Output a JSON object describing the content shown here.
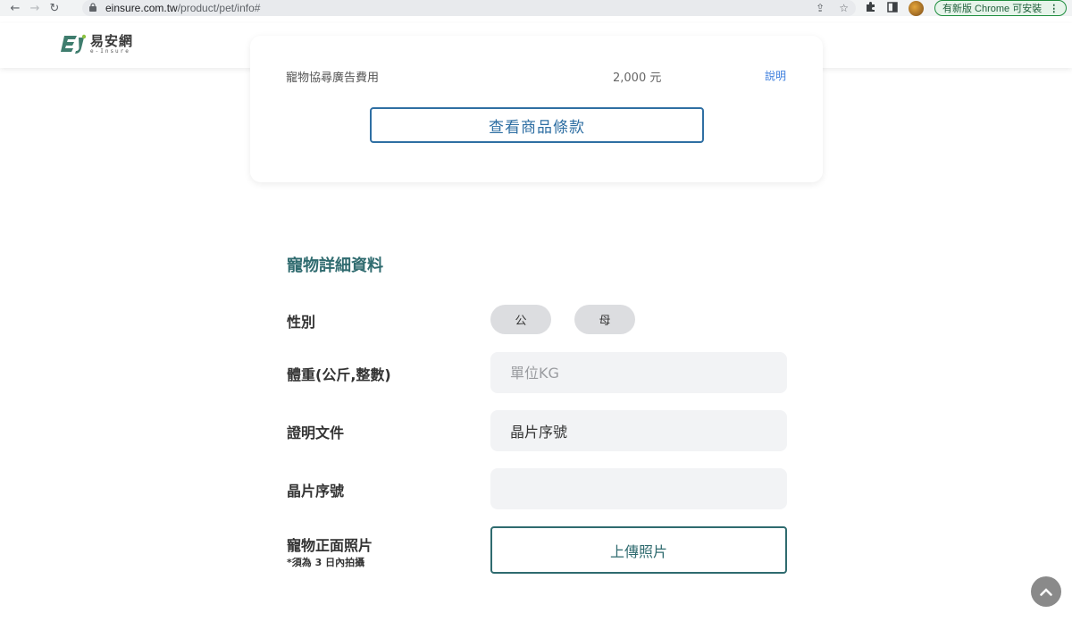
{
  "browser": {
    "url_domain": "einsure.com.tw",
    "url_path": "/product/pet/info#",
    "update_button": "有新版 Chrome 可安裝"
  },
  "site": {
    "logo_cn": "易安網",
    "logo_en": "e-Insure"
  },
  "coverage": {
    "fee_name": "寵物協尋廣告費用",
    "fee_amount": "2,000 元",
    "fee_link": "說明",
    "terms_button": "查看商品條款"
  },
  "pet_details": {
    "title": "寵物詳細資料",
    "gender_label": "性別",
    "gender_options": [
      "公",
      "母"
    ],
    "weight_label": "體重(公斤,整數)",
    "weight_placeholder": "單位KG",
    "document_label": "證明文件",
    "document_value": "晶片序號",
    "chip_label": "晶片序號",
    "chip_value": "",
    "photo_label": "寵物正面照片",
    "photo_note": "*須為 3 日內拍攝",
    "upload_button": "上傳照片"
  },
  "colors": {
    "teal": "#2f6b6f",
    "blue": "#2f6fa3",
    "link": "#3b7ddd"
  }
}
